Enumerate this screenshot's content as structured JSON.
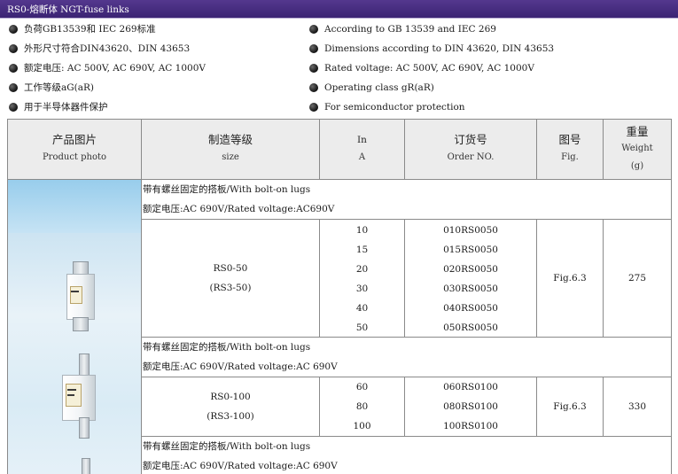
{
  "title": "RS0-熔断体 NGT-fuse links",
  "features_zh": [
    "负荷GB13539和 IEC 269标准",
    "外形尺寸符合DIN43620、DIN 43653",
    "额定电压: AC 500V, AC 690V, AC 1000V",
    "工作等级aG(aR)",
    "用于半导体器件保护"
  ],
  "features_en": [
    "According to GB 13539 and IEC 269",
    "Dimensions according to DIN 43620, DIN 43653",
    "Rated voltage: AC 500V, AC 690V, AC 1000V",
    "Operating class gR(aR)",
    "For semiconductor protection"
  ],
  "table": {
    "headers": [
      {
        "zh": "产品图片",
        "en": "Product photo"
      },
      {
        "zh": "制造等级",
        "en": "size"
      },
      {
        "zh": "In",
        "en": "A"
      },
      {
        "zh": "订货号",
        "en": "Order NO."
      },
      {
        "zh": "图号",
        "en": "Fig."
      },
      {
        "zh": "重量",
        "en": "Weight",
        "en2": "(g)"
      }
    ],
    "sections": [
      {
        "note_zh": "带有螺丝固定的搭板/With bolt-on lugs",
        "note_voltage": "额定电压:AC 690V/Rated voltage:AC690V",
        "size": "RS0-50",
        "size_alt": "(RS3-50)",
        "currents": [
          "10",
          "15",
          "20",
          "30",
          "40",
          "50"
        ],
        "orders": [
          "010RS0050",
          "015RS0050",
          "020RS0050",
          "030RS0050",
          "040RS0050",
          "050RS0050"
        ],
        "fig": "Fig.6.3",
        "weight": "275"
      },
      {
        "note_zh": "带有螺丝固定的搭板/With bolt-on lugs",
        "note_voltage": "额定电压:AC 690V/Rated voltage:AC 690V",
        "size": "RS0-100",
        "size_alt": "(RS3-100)",
        "currents": [
          "60",
          "80",
          "100"
        ],
        "orders": [
          "060RS0100",
          "080RS0100",
          "100RS0100"
        ],
        "fig": "Fig.6.3",
        "weight": "330"
      },
      {
        "note_zh": "带有螺丝固定的搭板/With bolt-on lugs",
        "note_voltage": "额定电压:AC 690V/Rated voltage:AC 690V"
      }
    ]
  },
  "colors": {
    "title_bar": "#3b2473",
    "header_bg": "#ececec",
    "border": "#8a8a8a",
    "photo_bg": "#cde4f2"
  },
  "icons": [
    "bullet-dot-icon",
    "fuse-photo"
  ]
}
